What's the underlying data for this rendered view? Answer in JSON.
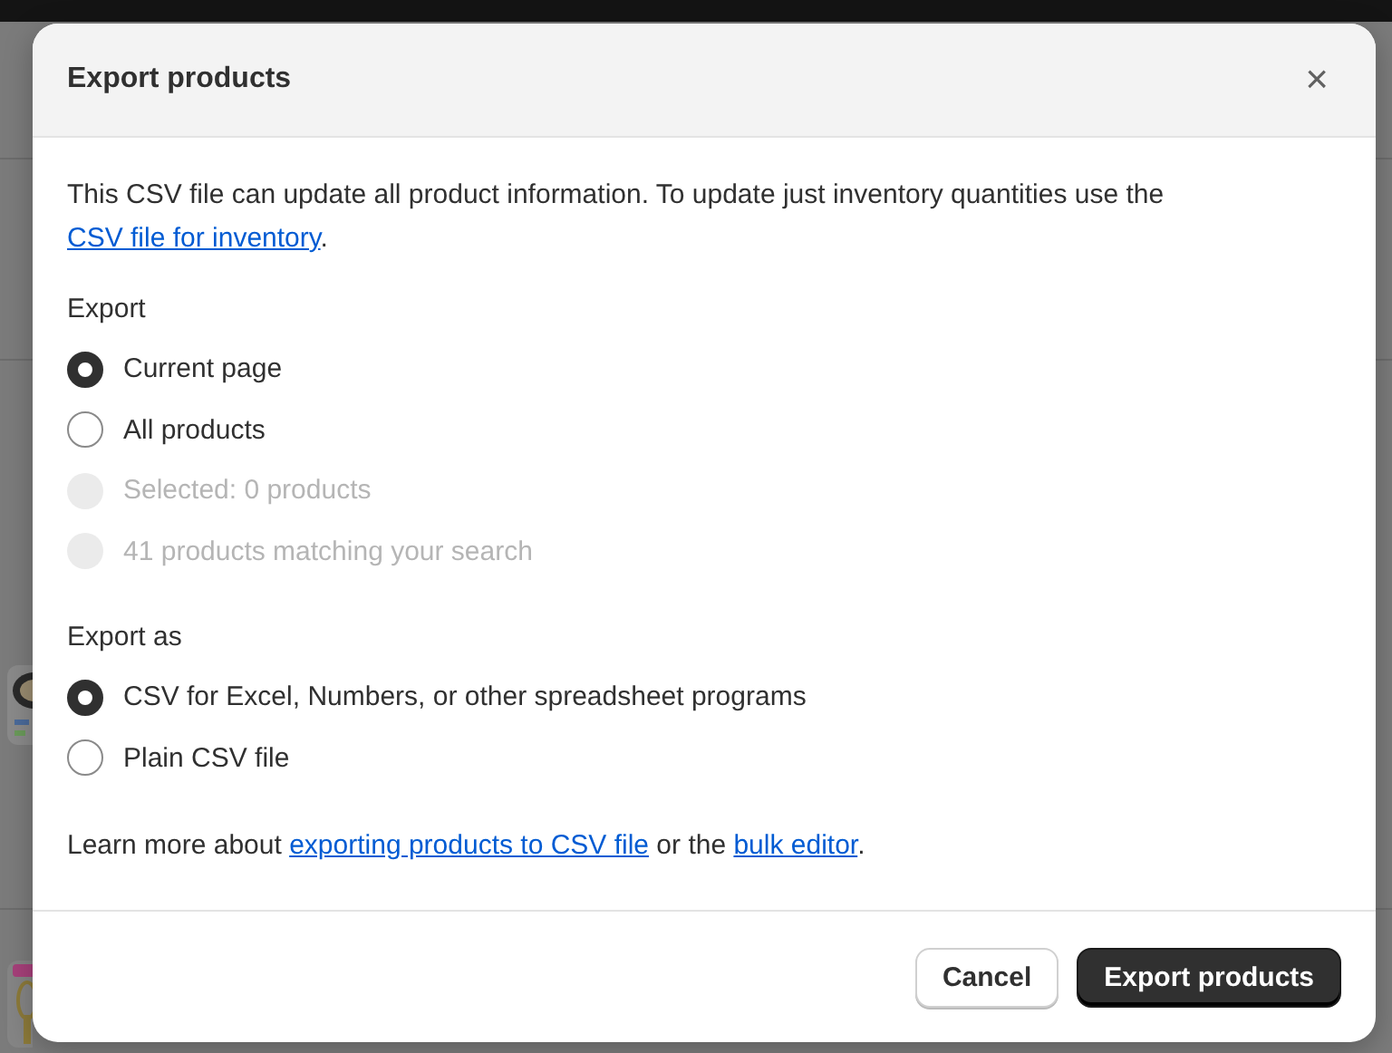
{
  "dialog": {
    "title": "Export products",
    "close": "×",
    "intro": {
      "text": "This CSV file can update all product information. To update just inventory quantities use the ",
      "link": "CSV file for inventory",
      "end": "."
    },
    "export": {
      "label": "Export",
      "options": [
        {
          "label": "Current page",
          "selected": true,
          "disabled": false
        },
        {
          "label": "All products",
          "selected": false,
          "disabled": false
        },
        {
          "label": "Selected: 0 products",
          "selected": false,
          "disabled": true
        },
        {
          "label": "41 products matching your search",
          "selected": false,
          "disabled": true
        }
      ]
    },
    "export_as": {
      "label": "Export as",
      "options": [
        {
          "label": "CSV for Excel, Numbers, or other spreadsheet programs",
          "selected": true,
          "disabled": false
        },
        {
          "label": "Plain CSV file",
          "selected": false,
          "disabled": false
        }
      ]
    },
    "learn_more": {
      "text": "Learn more about ",
      "link_1": "exporting products to CSV file",
      "middle": " or the ",
      "link_2": "bulk editor",
      "end": "."
    },
    "buttons": [
      {
        "label": "Cancel",
        "kind": "secondary"
      },
      {
        "label": "Export products",
        "kind": "primary"
      }
    ]
  }
}
